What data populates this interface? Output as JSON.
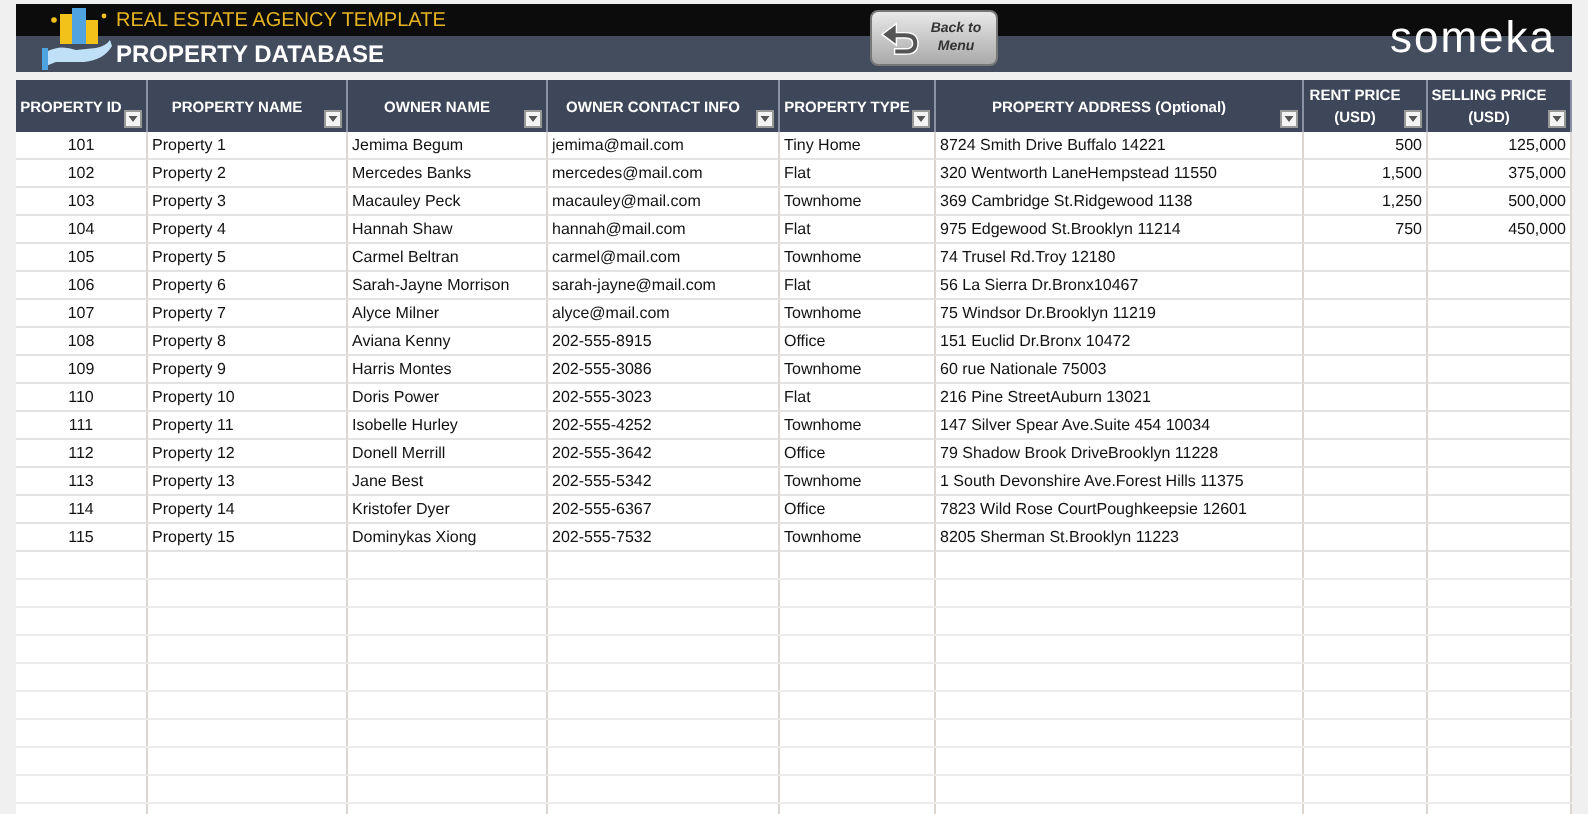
{
  "header": {
    "app_title": "REAL ESTATE AGENCY TEMPLATE",
    "page_title": "PROPERTY DATABASE",
    "back_button": "Back to Menu",
    "brand": "someka"
  },
  "table": {
    "columns": [
      {
        "label": "PROPERTY ID"
      },
      {
        "label": "PROPERTY NAME"
      },
      {
        "label": "OWNER NAME"
      },
      {
        "label": "OWNER CONTACT INFO"
      },
      {
        "label": "PROPERTY TYPE"
      },
      {
        "label": "PROPERTY ADDRESS (Optional)"
      },
      {
        "label": "RENT PRICE (USD)"
      },
      {
        "label": "SELLING PRICE (USD)"
      }
    ],
    "rows": [
      [
        "101",
        "Property 1",
        "Jemima Begum",
        "jemima@mail.com",
        "Tiny Home",
        "8724 Smith Drive Buffalo 14221",
        "500",
        "125,000"
      ],
      [
        "102",
        "Property 2",
        "Mercedes Banks",
        "mercedes@mail.com",
        "Flat",
        "320 Wentworth LaneHempstead 11550",
        "1,500",
        "375,000"
      ],
      [
        "103",
        "Property 3",
        "Macauley Peck",
        "macauley@mail.com",
        "Townhome",
        "369 Cambridge St.Ridgewood 1138",
        "1,250",
        "500,000"
      ],
      [
        "104",
        "Property 4",
        "Hannah Shaw",
        "hannah@mail.com",
        "Flat",
        "975 Edgewood St.Brooklyn 11214",
        "750",
        "450,000"
      ],
      [
        "105",
        "Property 5",
        "Carmel Beltran",
        "carmel@mail.com",
        "Townhome",
        "74 Trusel Rd.Troy 12180"
      ],
      [
        "106",
        "Property 6",
        "Sarah-Jayne Morrison",
        "sarah-jayne@mail.com",
        "Flat",
        "56 La Sierra Dr.Bronx10467"
      ],
      [
        "107",
        "Property 7",
        "Alyce Milner",
        "alyce@mail.com",
        "Townhome",
        "75 Windsor Dr.Brooklyn 11219"
      ],
      [
        "108",
        "Property 8",
        "Aviana Kenny",
        "202-555-8915",
        "Office",
        "151 Euclid Dr.Bronx 10472"
      ],
      [
        "109",
        "Property 9",
        "Harris Montes",
        "202-555-3086",
        "Townhome",
        "60 rue Nationale 75003"
      ],
      [
        "110",
        "Property 10",
        "Doris Power",
        "202-555-3023",
        "Flat",
        "216 Pine StreetAuburn 13021"
      ],
      [
        "111",
        "Property 11",
        "Isobelle Hurley",
        "202-555-4252",
        "Townhome",
        "147 Silver Spear Ave.Suite 454 10034"
      ],
      [
        "112",
        "Property 12",
        "Donell Merrill",
        "202-555-3642",
        "Office",
        "79 Shadow Brook DriveBrooklyn 11228"
      ],
      [
        "113",
        "Property 13",
        "Jane Best",
        "202-555-5342",
        "Townhome",
        "1 South Devonshire Ave.Forest Hills 11375"
      ],
      [
        "114",
        "Property 14",
        "Kristofer Dyer",
        "202-555-6367",
        "Office",
        "7823 Wild Rose CourtPoughkeepsie 12601"
      ],
      [
        "115",
        "Property 15",
        "Dominykas Xiong",
        "202-555-7532",
        "Townhome",
        "8205 Sherman St.Brooklyn 11223"
      ]
    ]
  }
}
